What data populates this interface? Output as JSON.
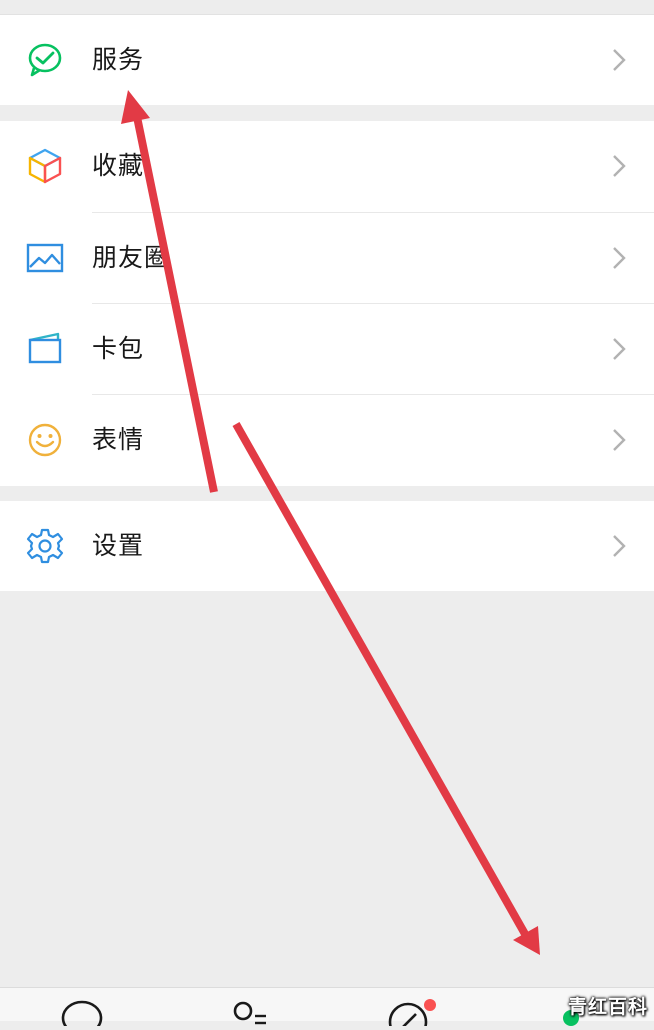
{
  "menu": {
    "services": {
      "label": "服务",
      "icon": "services-check-bubble-icon"
    },
    "favorites": {
      "label": "收藏",
      "icon": "favorites-cube-icon"
    },
    "moments": {
      "label": "朋友圈",
      "icon": "moments-picture-icon"
    },
    "card_wallet": {
      "label": "卡包",
      "icon": "card-wallet-icon"
    },
    "stickers": {
      "label": "表情",
      "icon": "stickers-smiley-icon"
    },
    "settings": {
      "label": "设置",
      "icon": "settings-gear-icon"
    }
  },
  "tabbar": {
    "tabs": [
      "chats-tab",
      "contacts-tab",
      "discover-tab",
      "me-tab"
    ],
    "discover_badge": true
  },
  "watermark": {
    "text": "青红百科"
  },
  "colors": {
    "accent_green": "#07c160",
    "badge_red": "#fa5151",
    "arrow_red": "#e23a45",
    "background": "#ededed"
  }
}
